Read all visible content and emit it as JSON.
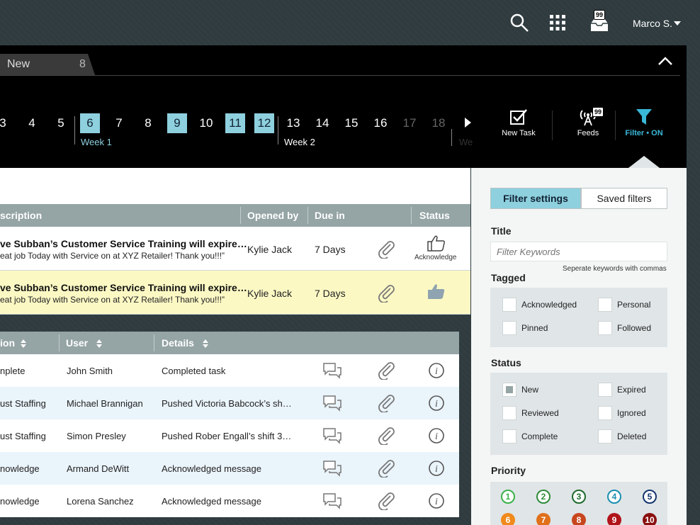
{
  "header": {
    "user_name": "Marco S.",
    "inbox_badge": "99"
  },
  "tab": {
    "label": "New",
    "count": "8"
  },
  "calendar": {
    "days": [
      {
        "n": "3",
        "state": "normal"
      },
      {
        "n": "4",
        "state": "normal"
      },
      {
        "n": "5",
        "state": "normal"
      },
      {
        "n": "6",
        "state": "selected"
      },
      {
        "n": "7",
        "state": "normal"
      },
      {
        "n": "8",
        "state": "normal"
      },
      {
        "n": "9",
        "state": "selected"
      },
      {
        "n": "10",
        "state": "normal"
      },
      {
        "n": "11",
        "state": "selected"
      },
      {
        "n": "12",
        "state": "selected"
      },
      {
        "n": "13",
        "state": "normal"
      },
      {
        "n": "14",
        "state": "normal"
      },
      {
        "n": "15",
        "state": "normal"
      },
      {
        "n": "16",
        "state": "normal"
      },
      {
        "n": "17",
        "state": "dim"
      },
      {
        "n": "18",
        "state": "dim"
      }
    ],
    "week1": "Week 1",
    "week2": "Week 2",
    "week3_partial": "We"
  },
  "tools": {
    "new_task": "New Task",
    "feeds": "Feeds",
    "feeds_badge": "99",
    "filter": "Filter • ON"
  },
  "table1": {
    "headers": {
      "description": "scription",
      "opened_by": "Opened by",
      "due_in": "Due in",
      "status": "Status"
    },
    "rows": [
      {
        "title": "ve Subban’s Customer Service Training will expire…",
        "sub": "eat job Today with Service on at XYZ Retailer! Thank you!!!”",
        "opened_by": "Kylie Jack",
        "due": "7 Days",
        "status_label": "Acknowledge"
      },
      {
        "title": "ve Subban’s Customer Service Training will expire…",
        "sub": "eat job Today with Service on at XYZ Retailer! Thank you!!!”",
        "opened_by": "Kylie Jack",
        "due": "7 Days",
        "status_label": ""
      }
    ]
  },
  "table2": {
    "headers": {
      "action": "ion",
      "user": "User",
      "details": "Details"
    },
    "rows": [
      {
        "action": "nplete",
        "user": "John Smith",
        "details": "Completed task"
      },
      {
        "action": "ust Staffing",
        "user": "Michael Brannigan",
        "details": "Pushed Victoria Babcock’s sh…"
      },
      {
        "action": "ust Staffing",
        "user": "Simon Presley",
        "details": "Pushed Rober Engall’s shift 3…"
      },
      {
        "action": "nowledge",
        "user": "Armand DeWitt",
        "details": "Acknowledged message"
      },
      {
        "action": "nowledge",
        "user": "Lorena Sanchez",
        "details": "Acknowledged message"
      }
    ]
  },
  "sidebar": {
    "tab_filter": "Filter settings",
    "tab_saved": "Saved filters",
    "title_heading": "Title",
    "keywords_placeholder": "Filter Keywords",
    "keywords_hint": "Seperate keywords with commas",
    "tagged_heading": "Tagged",
    "tagged": [
      {
        "label": "Acknowledged",
        "checked": false
      },
      {
        "label": "Personal",
        "checked": false
      },
      {
        "label": "Pinned",
        "checked": false
      },
      {
        "label": "Followed",
        "checked": false
      }
    ],
    "status_heading": "Status",
    "status": [
      {
        "label": "New",
        "checked": true
      },
      {
        "label": "Expired",
        "checked": false
      },
      {
        "label": "Reviewed",
        "checked": false
      },
      {
        "label": "Ignored",
        "checked": false
      },
      {
        "label": "Complete",
        "checked": false
      },
      {
        "label": "Deleted",
        "checked": false
      }
    ],
    "priority_heading": "Priority",
    "priorities": [
      {
        "n": "1",
        "color": "#3bb24a"
      },
      {
        "n": "2",
        "color": "#2e8b3a"
      },
      {
        "n": "3",
        "color": "#1d6b2c"
      },
      {
        "n": "4",
        "color": "#1a8fb0"
      },
      {
        "n": "5",
        "color": "#15356e"
      },
      {
        "n": "6",
        "color": "#f08a1c"
      },
      {
        "n": "7",
        "color": "#e0701a"
      },
      {
        "n": "8",
        "color": "#c8461e"
      },
      {
        "n": "9",
        "color": "#b0141a"
      },
      {
        "n": "10",
        "color": "#8a1010"
      }
    ]
  },
  "colors": {
    "accent": "#8ed0de",
    "filter_on": "#3ab8d8",
    "highlight_row": "#fbf8c4"
  }
}
